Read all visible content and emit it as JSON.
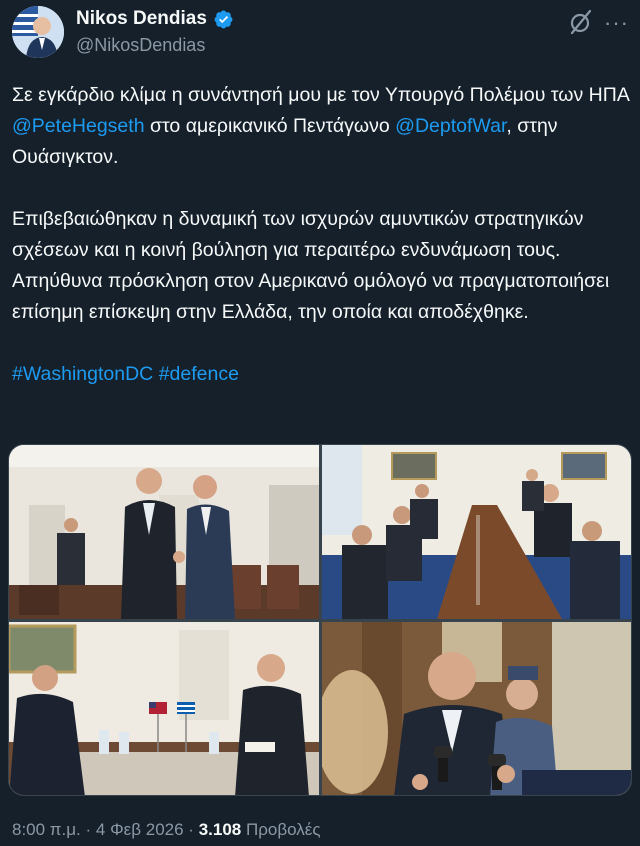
{
  "author": {
    "display_name": "Nikos Dendias",
    "handle": "@NikosDendias",
    "verified": true
  },
  "tweet": {
    "paragraphs": [
      [
        {
          "text": "Σε εγκάρδιο κλίμα η συνάντησή μου με τον Υπουργό Πολέμου των ΗΠΑ ",
          "kind": "text"
        },
        {
          "text": "@PeteHegseth",
          "kind": "mention"
        },
        {
          "text": " στο αμερικανικό Πεντάγωνο ",
          "kind": "text"
        },
        {
          "text": "@DeptofWar",
          "kind": "mention"
        },
        {
          "text": ", στην Ουάσιγκτον.",
          "kind": "text"
        }
      ],
      [
        {
          "text": "Επιβεβαιώθηκαν η δυναμική των ισχυρών αμυντικών στρατηγικών σχέσεων και η κοινή βούληση για περαιτέρω ενδυνάμωση τους. Απηύθυνα πρόσκληση στον Αμερικανό ομόλογό να πραγματοποιήσει επίσημη επίσκεψη στην Ελλάδα, την οποία και αποδέχθηκε.",
          "kind": "text"
        }
      ],
      [
        {
          "text": "#WashingtonDC",
          "kind": "hashtag"
        },
        {
          "text": " ",
          "kind": "text"
        },
        {
          "text": "#defence",
          "kind": "hashtag"
        }
      ]
    ]
  },
  "media": {
    "photos": [
      {
        "id": "photo-handshake"
      },
      {
        "id": "photo-conference-table"
      },
      {
        "id": "photo-meeting-flags"
      },
      {
        "id": "photo-press-microphones"
      }
    ]
  },
  "footer": {
    "time": "8:00 π.μ.",
    "separator": "·",
    "date": "4 Φεβ 2026",
    "views_count": "3.108",
    "views_label": "Προβολές"
  },
  "icons": {
    "verified": "verified-badge-icon",
    "grok": "grok-icon",
    "more": "more-options-icon"
  },
  "colors": {
    "background": "#15202b",
    "text": "#f7f9f9",
    "secondary_text": "#8b98a5",
    "link": "#1d9bf0",
    "verified": "#1d9bf0",
    "border": "#38444d"
  }
}
